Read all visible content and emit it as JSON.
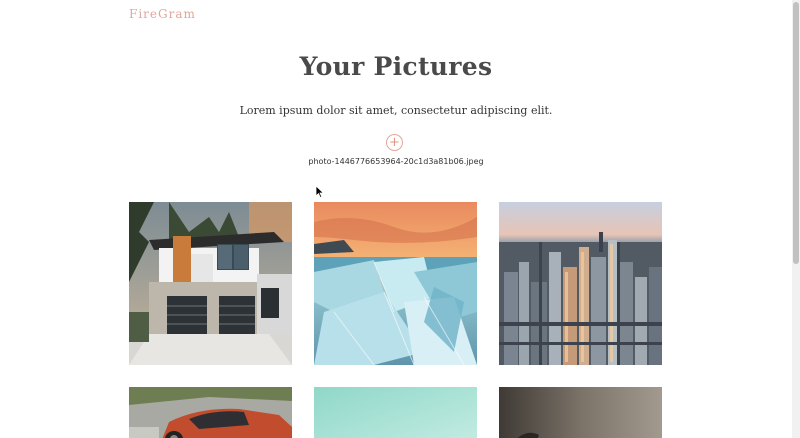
{
  "brand": "FireGram",
  "header": {
    "title": "Your Pictures",
    "subtitle": "Lorem ipsum dolor sit amet, consectetur adipiscing elit."
  },
  "upload": {
    "icon": "plus-icon",
    "glyph": "+",
    "filename": "photo-1446776653964-20c1d3a81b06.jpeg"
  },
  "colors": {
    "brand": "#e0a79a",
    "accent": "#e6a596",
    "title": "#4a4a4a"
  },
  "gallery": [
    {
      "name": "modern-house-photo"
    },
    {
      "name": "ice-shards-sunset-photo"
    },
    {
      "name": "city-skyline-aerial-photo"
    },
    {
      "name": "red-sports-car-photo"
    },
    {
      "name": "teal-gradient-photo"
    },
    {
      "name": "dark-blurred-photo"
    }
  ]
}
